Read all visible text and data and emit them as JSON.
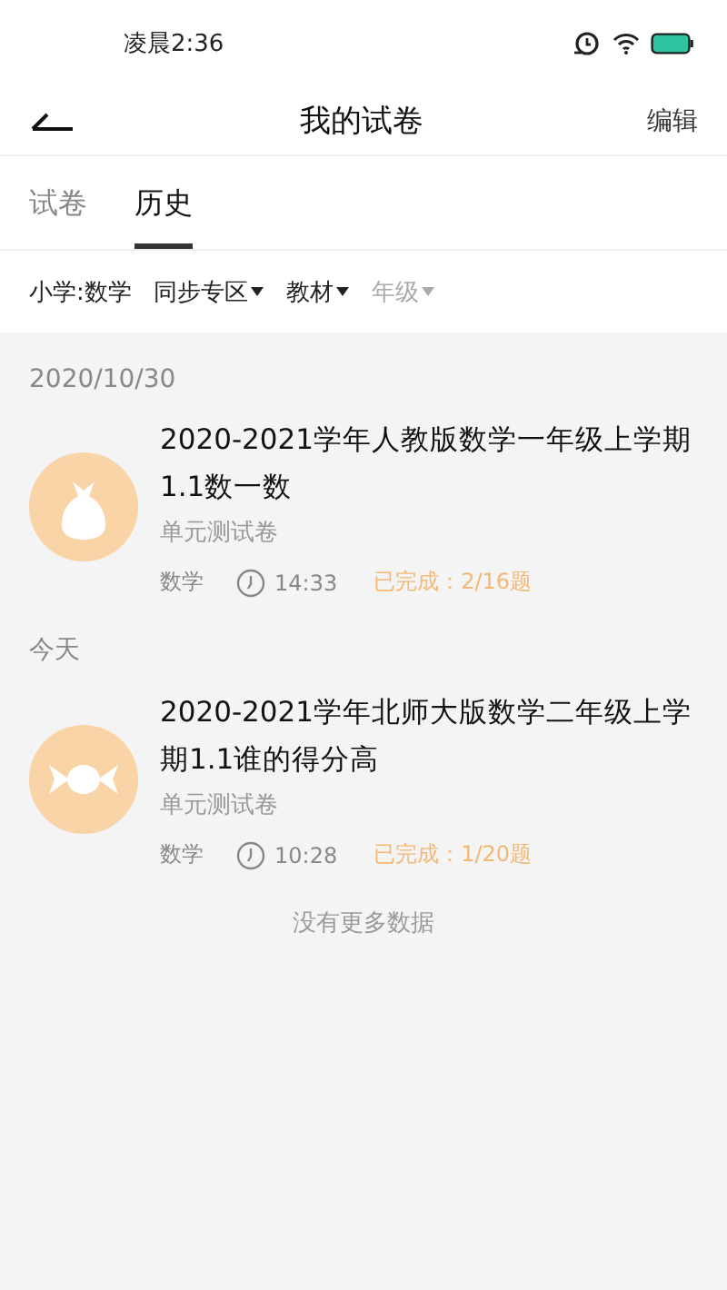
{
  "status_bar": {
    "time": "凌晨2:36"
  },
  "header": {
    "title": "我的试卷",
    "action": "编辑"
  },
  "tabs": [
    {
      "label": "试卷",
      "selected": false
    },
    {
      "label": "历史",
      "selected": true
    }
  ],
  "filters": [
    {
      "kind": "label",
      "label": "小学:数学",
      "disabled": false
    },
    {
      "kind": "dropdown",
      "label": "同步专区",
      "disabled": false
    },
    {
      "kind": "dropdown",
      "label": "教材",
      "disabled": false
    },
    {
      "kind": "dropdown",
      "label": "年级",
      "disabled": true
    }
  ],
  "groups": [
    {
      "date": "2020/10/30",
      "items": [
        {
          "kind": "bag",
          "title": "2020-2021学年人教版数学一年级上学期1.1数一数",
          "type": "单元测试卷",
          "subject": "数学",
          "time": "14:33",
          "progress": "已完成：2/16题"
        }
      ]
    },
    {
      "date": "今天",
      "items": [
        {
          "kind": "candy",
          "title": "2020-2021学年北师大版数学二年级上学期1.1谁的得分高",
          "type": "单元测试卷",
          "subject": "数学",
          "time": "10:28",
          "progress": "已完成：1/20题"
        }
      ]
    }
  ],
  "footer": "没有更多数据"
}
